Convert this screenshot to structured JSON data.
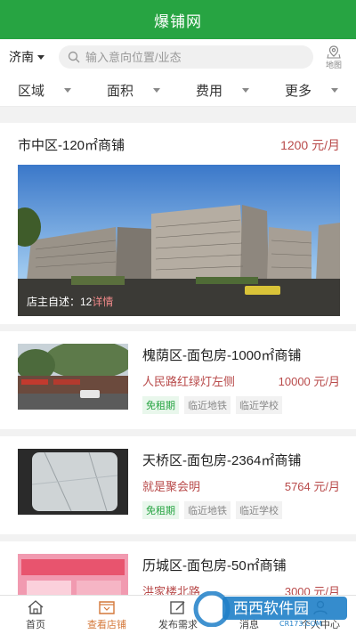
{
  "app": {
    "title": "爆铺网"
  },
  "search": {
    "city": "济南",
    "placeholder": "输入意向位置/业态",
    "map_label": "地图"
  },
  "filters": [
    "区域",
    "面积",
    "费用",
    "更多"
  ],
  "featured": {
    "title": "市中区-120㎡商铺",
    "price": "1200 元/月",
    "desc_prefix": "店主自述：12",
    "desc_more": "详情"
  },
  "listings": [
    {
      "title": "槐荫区-面包房-1000㎡商铺",
      "address": "人民路红绿灯左侧",
      "price": "10000 元/月",
      "tags": [
        "免租期",
        "临近地铁",
        "临近学校"
      ]
    },
    {
      "title": "天桥区-面包房-2364㎡商铺",
      "address": "就是聚会明",
      "price": "5764 元/月",
      "tags": [
        "免租期",
        "临近地铁",
        "临近学校"
      ]
    },
    {
      "title": "历城区-面包房-50㎡商铺",
      "address": "洪家楼北路",
      "price": "3000 元/月",
      "tags": []
    }
  ],
  "tabs": [
    "首页",
    "查看店铺",
    "发布需求",
    "消息",
    "个人中心"
  ],
  "watermark": {
    "text": "西西软件园",
    "sub": "CR173.COM"
  },
  "colors": {
    "brand": "#27a442",
    "price": "#b84a4a",
    "active_tab": "#d4783a"
  }
}
